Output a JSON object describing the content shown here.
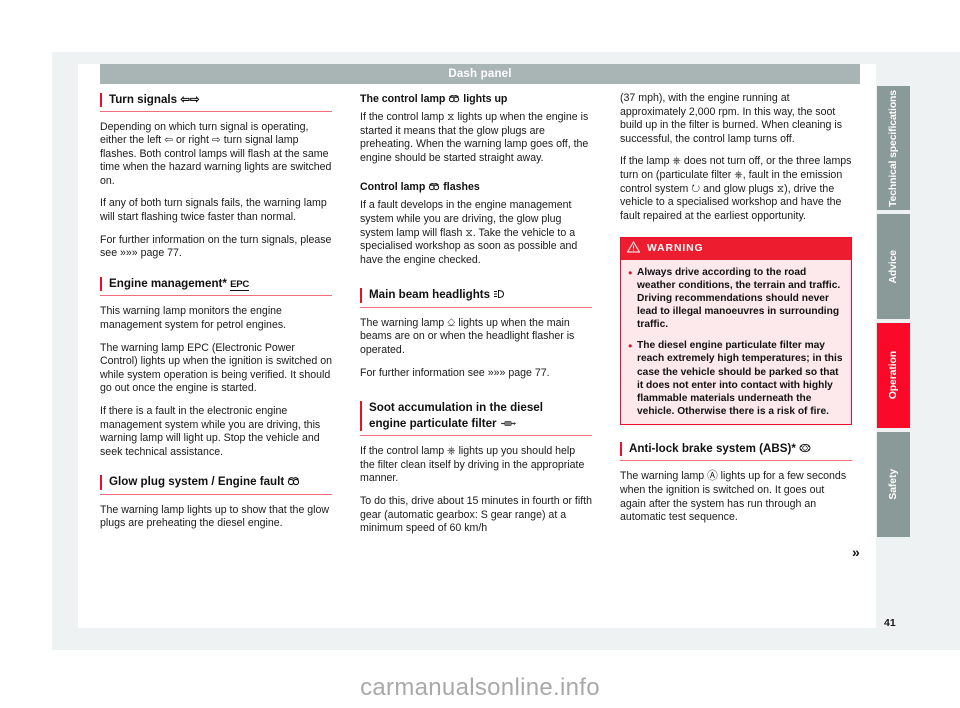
{
  "header": {
    "title": "Dash panel"
  },
  "page": {
    "number": "41",
    "continuation": "»"
  },
  "watermark": "carmanualsonline.info",
  "tabs": [
    {
      "label": "Technical specifications",
      "active": false
    },
    {
      "label": "Advice",
      "active": false
    },
    {
      "label": "Operation",
      "active": true
    },
    {
      "label": "Safety",
      "active": false
    }
  ],
  "colors": {
    "accent_red": "#e8112d",
    "warning_red": "#ed1c2e",
    "warning_bg": "#fde9ec",
    "title_bar": "#a8b5b4",
    "tab_gray": "#8a9a98",
    "tab_active": "#fa0a28",
    "rule_pink": "#f06d7a"
  },
  "column1": {
    "section1": {
      "heading": "Turn signals",
      "heading_icons": [
        "turn-signal-left-arrow-icon",
        "turn-signal-right-arrow-icon"
      ],
      "paragraphs": [
        "Depending on which turn signal is operating, either the left ⇦ or right ⇨ turn signal lamp flashes. Both control lamps will flash at the same time when the hazard warning lights are switched on.",
        "If any of both turn signals fails, the warning lamp will start flashing twice faster than normal.",
        "For further information on the turn signals, please see »»» page 77."
      ]
    },
    "section2": {
      "heading": "Engine management*",
      "heading_icon": "epc-icon",
      "paragraphs": [
        "This warning lamp monitors the engine management system for petrol engines.",
        "The warning lamp EPC (Electronic Power Control) lights up when the ignition is switched on while system operation is being verified. It should go out once the engine is started.",
        "If there is a fault in the electronic engine management system while you are driving, this warning lamp will light up. Stop the vehicle and seek technical assistance."
      ]
    },
    "section3": {
      "heading": "Glow plug system / Engine fault",
      "heading_icon": "glow-plug-icon",
      "paragraphs": [
        "The warning lamp lights up to show that the glow plugs are preheating the diesel engine."
      ]
    }
  },
  "column2": {
    "block1": {
      "subheading_pre": "The control lamp",
      "subheading_post": "lights up",
      "subheading_icon": "glow-plug-icon",
      "paragraphs": [
        "If the control lamp ⧖ lights up when the engine is started it means that the glow plugs are preheating. When the warning lamp goes off, the engine should be started straight away."
      ]
    },
    "block2": {
      "subheading_pre": "Control lamp",
      "subheading_post": "flashes",
      "subheading_icon": "glow-plug-icon",
      "paragraphs": [
        "If a fault develops in the engine management system while you are driving, the glow plug system lamp will flash ⧖. Take the vehicle to a specialised workshop as soon as possible and have the engine checked."
      ]
    },
    "section1": {
      "heading": "Main beam headlights",
      "heading_icon": "main-beam-icon",
      "paragraphs": [
        "The warning lamp ⎐ lights up when the main beams are on or when the headlight flasher is operated.",
        "For further information see »»» page 77."
      ]
    },
    "section2": {
      "heading_line1": "Soot accumulation in the diesel",
      "heading_line2": "engine particulate filter",
      "heading_icon": "particulate-filter-icon",
      "paragraphs": [
        "If the control lamp ⎈ lights up you should help the filter clean itself by driving in the appropriate manner.",
        "To do this, drive about 15 minutes in fourth or fifth gear (automatic gearbox: S gear range) at a minimum speed of 60 km/h"
      ]
    }
  },
  "column3": {
    "paragraphs": [
      "(37 mph), with the engine running at approximately 2,000 rpm. In this way, the soot build up in the filter is burned. When cleaning is successful, the control lamp turns off.",
      "If the lamp ⎈ does not turn off, or the three lamps turn on (particulate filter ⎈, fault in the emission control system ↻ and glow plugs ⧖), drive the vehicle to a specialised workshop and have the fault repaired at the earliest opportunity."
    ],
    "warning": {
      "icon": "warning-triangle-icon",
      "title": "WARNING",
      "items": [
        "Always drive according to the road weather conditions, the terrain and traffic. Driving recommendations should never lead to illegal manoeuvres in surrounding traffic.",
        "The diesel engine particulate filter may reach extremely high temperatures; in this case the vehicle should be parked so that it does not enter into contact with highly flammable materials underneath the vehicle. Otherwise there is a risk of fire."
      ]
    },
    "section1": {
      "heading": "Anti-lock brake system (ABS)*",
      "heading_icon": "abs-icon",
      "paragraphs": [
        "The warning lamp Ⓐ lights up for a few seconds when the ignition is switched on. It goes out again after the system has run through an automatic test sequence."
      ]
    }
  }
}
